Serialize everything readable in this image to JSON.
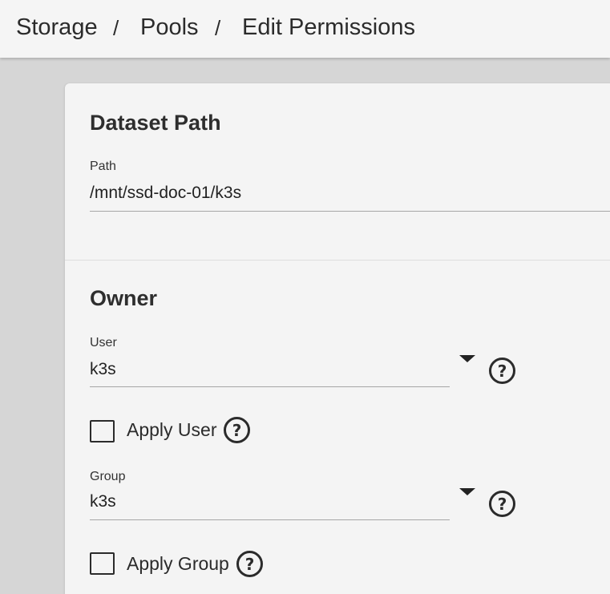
{
  "breadcrumb": {
    "items": [
      "Storage",
      "Pools",
      "Edit Permissions"
    ],
    "separator": "/"
  },
  "dataset_path": {
    "title": "Dataset Path",
    "path_label": "Path",
    "path_value": "/mnt/ssd-doc-01/k3s"
  },
  "owner": {
    "title": "Owner",
    "user_label": "User",
    "user_value": "k3s",
    "apply_user_label": "Apply User",
    "apply_user_checked": false,
    "group_label": "Group",
    "group_value": "k3s",
    "apply_group_label": "Apply Group",
    "apply_group_checked": false
  },
  "icons": {
    "help": "help-circle-icon",
    "dropdown": "caret-down-icon",
    "help_glyph": "?"
  }
}
